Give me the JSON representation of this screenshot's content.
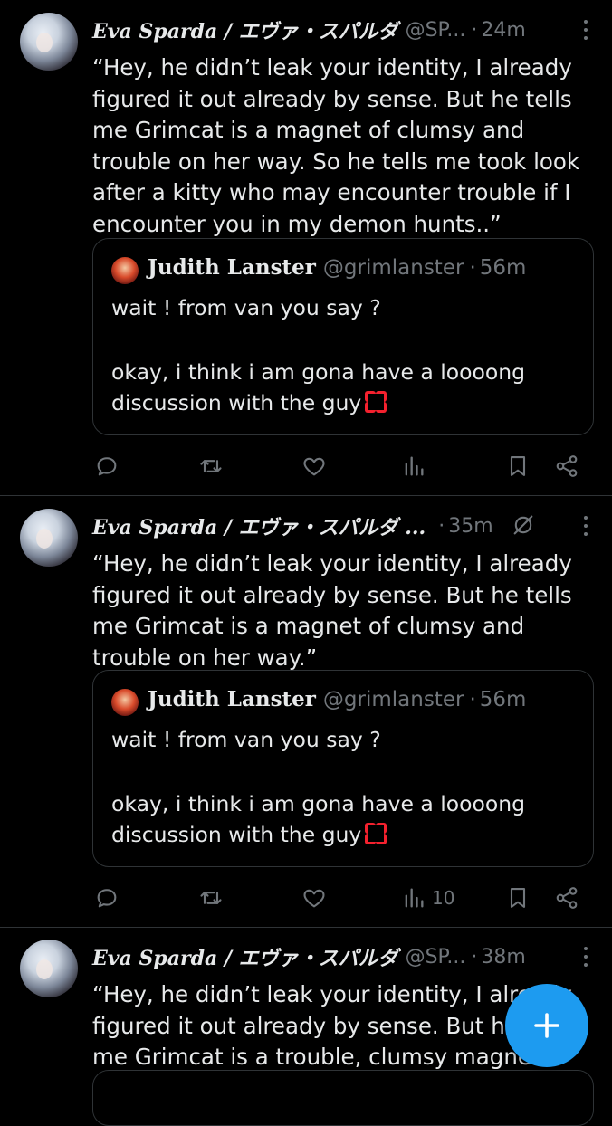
{
  "tweets": [
    {
      "author_name": "Eva Sparda / エヴァ・スパルダ",
      "handle": "@SP...",
      "time": "24m",
      "text": "“Hey, he didn’t leak your identity, I already figured it out already by sense. But he tells me Grimcat is a magnet of clumsy and trouble on her way. So he tells me took look after a kitty who may encounter trouble if I encounter you in my demon hunts..”",
      "quote": {
        "author_name": "Judith Lanster",
        "handle": "@grimlanster",
        "time": "56m",
        "line1": "wait ! from van you say ?",
        "line2": "okay, i think i am gona have a loooong discussion with the guy"
      },
      "views": ""
    },
    {
      "author_name": "Eva Sparda / エヴァ・スパルダ ...",
      "handle": "",
      "time": "35m",
      "text": "“Hey, he didn’t leak your identity, I already figured it out already by sense. But he tells me Grimcat is a magnet of clumsy and trouble on her way.”",
      "quote": {
        "author_name": "Judith Lanster",
        "handle": "@grimlanster",
        "time": "56m",
        "line1": "wait ! from van you say ?",
        "line2": "okay, i think i am gona have a loooong discussion with the guy"
      },
      "views": "10"
    },
    {
      "author_name": "Eva Sparda / エヴァ・スパルダ",
      "handle": "@SP...",
      "time": "38m",
      "text": "“Hey, he didn’t leak your identity, I already figured it out already by sense. But he tells me Grimcat is a trouble, clumsy magnet...”"
    }
  ],
  "dot_separator": "·",
  "icons": {
    "reply": "reply-icon",
    "retweet": "retweet-icon",
    "like": "heart-icon",
    "views": "views-icon",
    "bookmark": "bookmark-icon",
    "share": "share-icon",
    "more": "more-icon",
    "compose": "plus-icon",
    "muted": "muted-icon",
    "anger": "anger-emoji-icon"
  },
  "colors": {
    "background": "#000000",
    "text": "#e7e9ea",
    "secondary": "#71767b",
    "accent": "#1d9bf0",
    "divider": "#2f3336"
  }
}
